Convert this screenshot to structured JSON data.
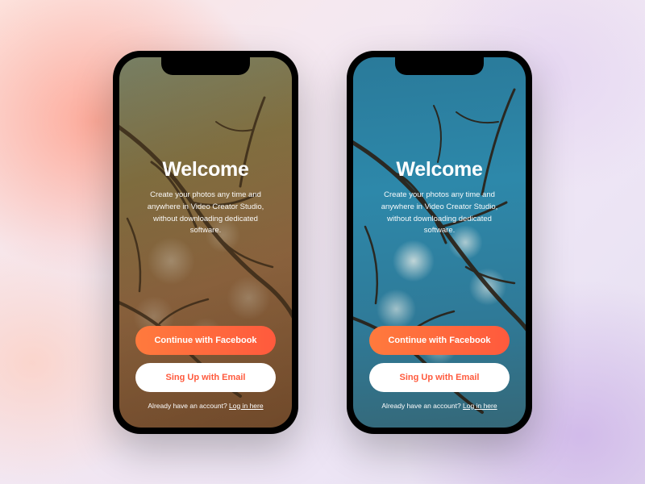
{
  "screens": {
    "left": {
      "title": "Welcome",
      "subtitle": "Create your photos any time and anywhere in Video Creator Studio, without downloading dedicated software.",
      "primary_button": "Continue with Facebook",
      "secondary_button": "Sing Up with Email",
      "login_prompt": "Already have an account? ",
      "login_link": "Log in here"
    },
    "right": {
      "title": "Welcome",
      "subtitle": "Create your photos any time and anywhere in Video Creator Studio, without downloading dedicated software.",
      "primary_button": "Continue with Facebook",
      "secondary_button": "Sing Up with Email",
      "login_prompt": "Already have an account? ",
      "login_link": "Log in here"
    }
  },
  "colors": {
    "accent_gradient_start": "#ff7a3d",
    "accent_gradient_end": "#ff5a3d",
    "secondary_bg": "#ffffff",
    "text_light": "#ffffff"
  }
}
